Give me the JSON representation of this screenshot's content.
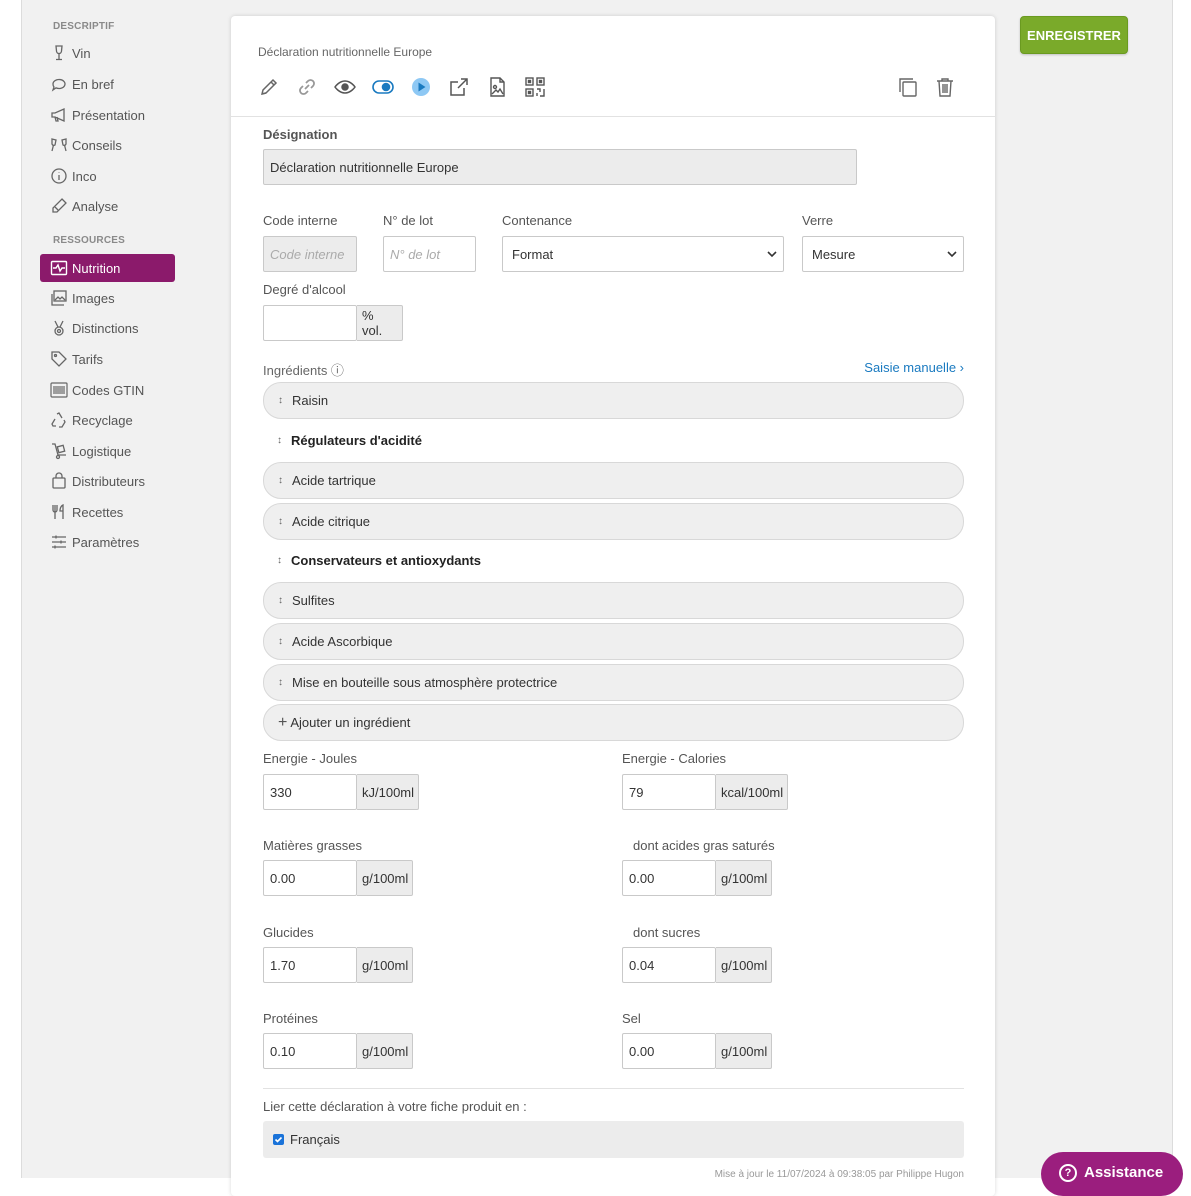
{
  "sidebar": {
    "section_descriptif": "DESCRIPTIF",
    "section_ressources": "RESSOURCES",
    "descriptif_items": [
      {
        "label": "Vin",
        "icon": "wine-glass-icon"
      },
      {
        "label": "En bref",
        "icon": "speech-bubble-icon"
      },
      {
        "label": "Présentation",
        "icon": "megaphone-icon"
      },
      {
        "label": "Conseils",
        "icon": "glasses-cheers-icon"
      },
      {
        "label": "Inco",
        "icon": "info-circle-icon"
      },
      {
        "label": "Analyse",
        "icon": "pipette-icon"
      }
    ],
    "ressources_items": [
      {
        "label": "Nutrition",
        "icon": "pulse-monitor-icon",
        "active": true
      },
      {
        "label": "Images",
        "icon": "images-icon"
      },
      {
        "label": "Distinctions",
        "icon": "medal-icon"
      },
      {
        "label": "Tarifs",
        "icon": "tag-icon"
      },
      {
        "label": "Codes GTIN",
        "icon": "barcode-icon"
      },
      {
        "label": "Recyclage",
        "icon": "recycle-icon"
      },
      {
        "label": "Logistique",
        "icon": "hand-truck-icon"
      },
      {
        "label": "Distributeurs",
        "icon": "shopping-bag-icon"
      },
      {
        "label": "Recettes",
        "icon": "utensils-icon"
      },
      {
        "label": "Paramètres",
        "icon": "sliders-icon"
      }
    ],
    "active_color": "#8b1a6b"
  },
  "card": {
    "title": "Déclaration nutritionnelle Europe",
    "toolbar_icons": [
      "pencil-icon",
      "link-icon",
      "eye-icon",
      "toggle-icon",
      "play-icon",
      "external-link-icon",
      "file-image-icon",
      "qr-code-icon"
    ],
    "toolbar_right_icons": [
      "copy-icon",
      "trash-icon"
    ]
  },
  "form": {
    "designation_label": "Désignation",
    "designation_value": "Déclaration nutritionnelle Europe",
    "code_interne_label": "Code interne",
    "code_interne_placeholder": "Code interne",
    "lot_label": "N° de lot",
    "lot_placeholder": "N° de lot",
    "contenance_label": "Contenance",
    "contenance_value": "Format",
    "verre_label": "Verre",
    "verre_value": "Mesure",
    "degre_label": "Degré d'alcool",
    "degre_value": "",
    "degre_unit": "% vol.",
    "ingredients_label": "Ingrédients ⓘ",
    "saisie_manuelle": "Saisie manuelle ›"
  },
  "ingredients": {
    "raisin": "Raisin",
    "group1": "Régulateurs d'acidité",
    "acide_tartrique": "Acide tartrique",
    "acide_citrique": "Acide citrique",
    "group2": "Conservateurs et antioxydants",
    "sulfites": "Sulfites",
    "acide_ascorbique": "Acide Ascorbique",
    "mise_en_bouteille": "Mise en bouteille sous atmosphère protectrice",
    "add": "Ajouter un ingrédient"
  },
  "nutrition": {
    "energie_j_label": "Energie - Joules",
    "energie_j_value": "330",
    "energie_j_unit": "kJ/100ml",
    "energie_c_label": "Energie - Calories",
    "energie_c_value": "79",
    "energie_c_unit": "kcal/100ml",
    "mg_label": "Matières grasses",
    "mg_value": "0.00",
    "mg_unit": "g/100ml",
    "ags_label": "dont acides gras saturés",
    "ags_value": "0.00",
    "ags_unit": "g/100ml",
    "glucides_label": "Glucides",
    "glucides_value": "1.70",
    "glucides_unit": "g/100ml",
    "sucres_label": "dont sucres",
    "sucres_value": "0.04",
    "sucres_unit": "g/100ml",
    "proteines_label": "Protéines",
    "proteines_value": "0.10",
    "proteines_unit": "g/100ml",
    "sel_label": "Sel",
    "sel_value": "0.00",
    "sel_unit": "g/100ml"
  },
  "link_section": {
    "label": "Lier cette déclaration à votre fiche produit en :",
    "language": "Français",
    "checked": true,
    "updated": "Mise à jour le 11/07/2024 à 09:38:05 par Philippe Hugon"
  },
  "buttons": {
    "save": "ENREGISTRER",
    "assistance": "Assistance",
    "save_color": "#7aaa2a",
    "assistance_color": "#9b1e7e"
  }
}
